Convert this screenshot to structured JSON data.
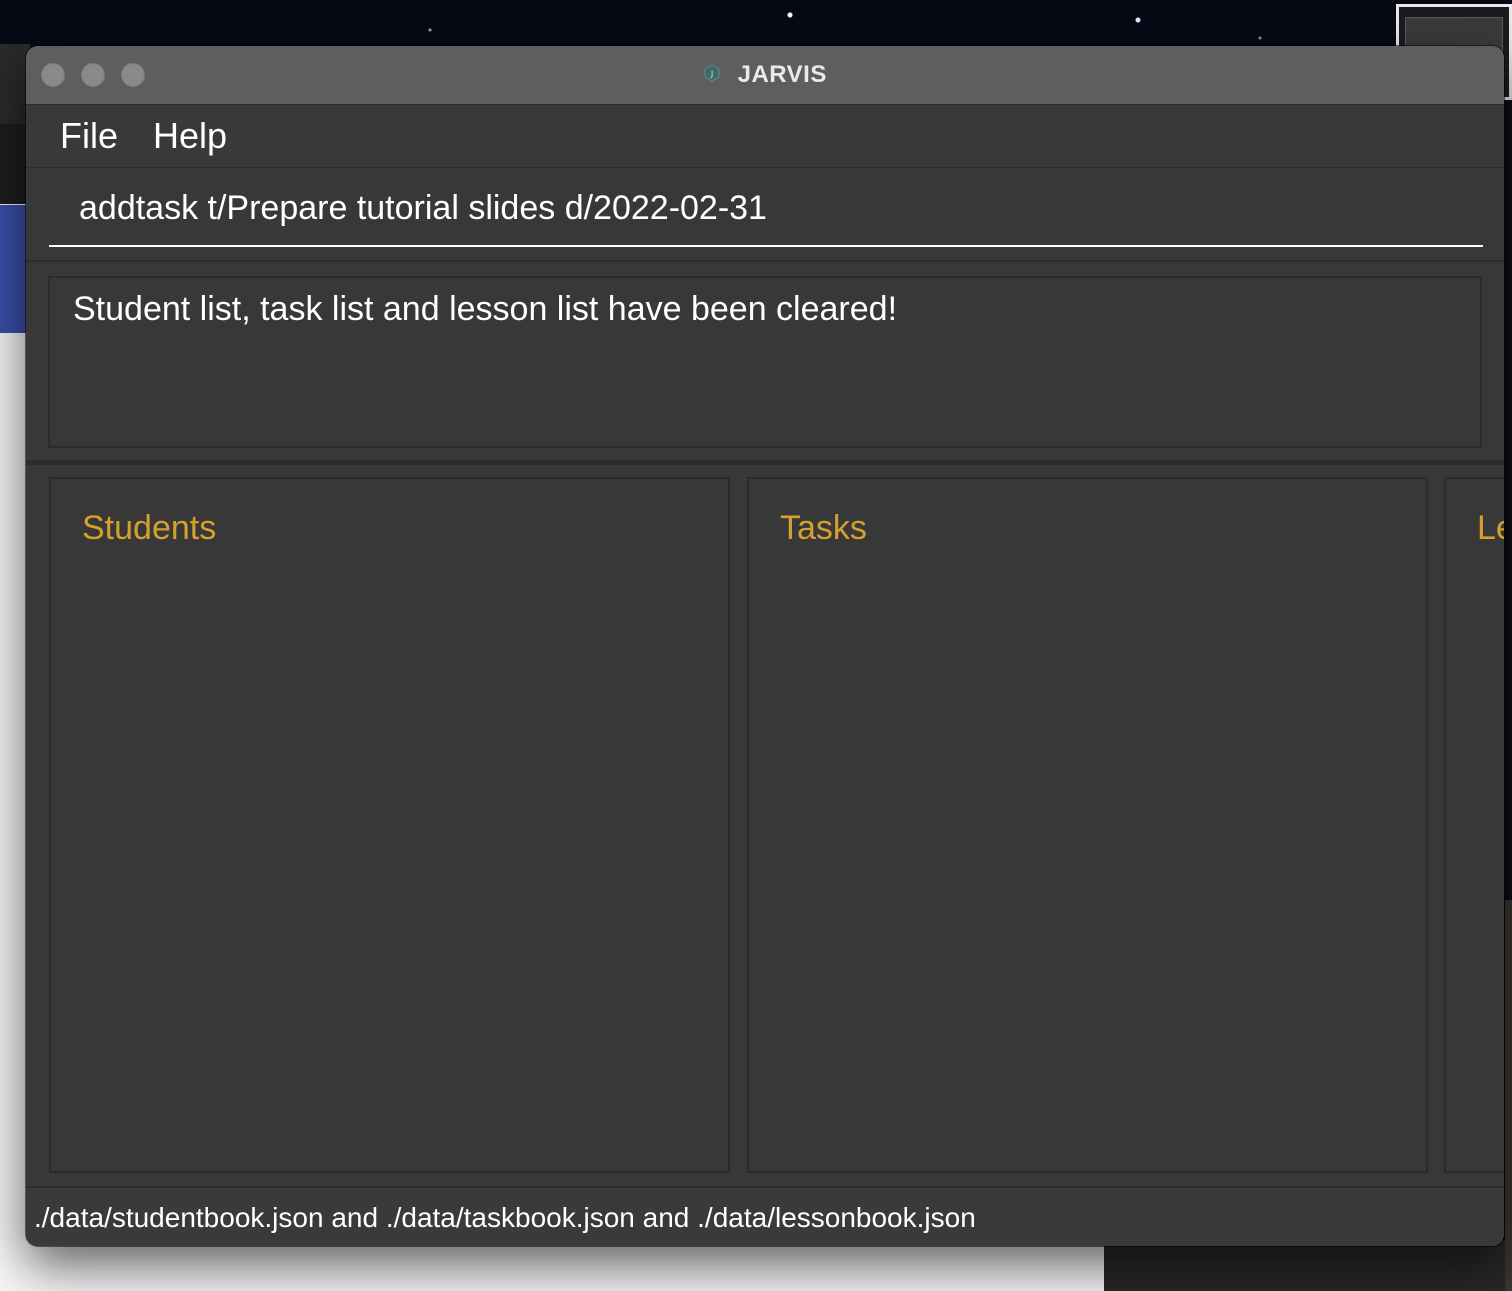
{
  "window": {
    "title": "JARVIS",
    "icon": "jarvis-app-icon"
  },
  "menu": {
    "items": [
      {
        "label": "File"
      },
      {
        "label": "Help"
      }
    ]
  },
  "command": {
    "value": "addtask t/Prepare tutorial slides d/2022-02-31"
  },
  "result": {
    "message": "Student list, task list and lesson list have been cleared!"
  },
  "panels": {
    "students": {
      "title": "Students"
    },
    "tasks": {
      "title": "Tasks"
    },
    "lessons": {
      "title": "Le"
    }
  },
  "status": {
    "text": "./data/studentbook.json and ./data/taskbook.json and ./data/lessonbook.json"
  },
  "colors": {
    "window_bg": "#383838",
    "titlebar": "#5e5e5e",
    "panel_title": "#d4a22c",
    "text": "#ffffff"
  }
}
